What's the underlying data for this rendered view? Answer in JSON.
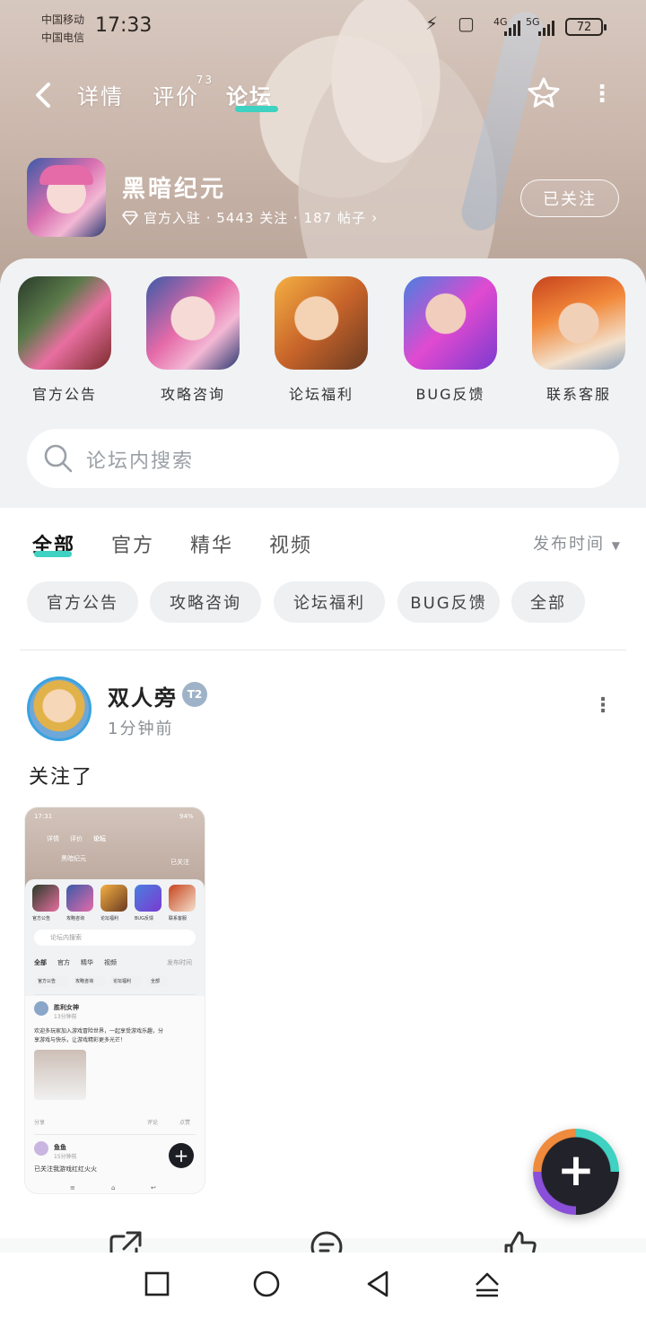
{
  "status_bar": {
    "carrier1": "中国移动",
    "carrier2": "中国电信",
    "time": "17:33",
    "net1": "4G",
    "net2": "5G",
    "battery": "72"
  },
  "nav": {
    "tabs": [
      {
        "label": "详情"
      },
      {
        "label": "评价",
        "count": "73"
      },
      {
        "label": "论坛"
      }
    ],
    "active_tab": "论坛"
  },
  "game": {
    "name": "黑暗纪元",
    "meta": "官方入驻 · 5443 关注 · 187 帖子",
    "follow_label": "已关注"
  },
  "categories": [
    {
      "label": "官方公告"
    },
    {
      "label": "攻略咨询"
    },
    {
      "label": "论坛福利"
    },
    {
      "label": "BUG反馈"
    },
    {
      "label": "联系客服"
    }
  ],
  "search": {
    "placeholder": "论坛内搜索"
  },
  "filter": {
    "tabs": [
      "全部",
      "官方",
      "精华",
      "视频"
    ],
    "sort_label": "发布时间",
    "chips": [
      "官方公告",
      "攻略咨询",
      "论坛福利",
      "BUG反馈",
      "全部"
    ]
  },
  "post": {
    "author": "双人旁",
    "level": "T2",
    "time": "1分钟前",
    "text": "关注了"
  },
  "thumb": {
    "time": "17:31",
    "battery": "94%",
    "tabs": [
      "详情",
      "评价",
      "论坛"
    ],
    "game_name": "黑暗纪元",
    "follow": "已关注",
    "cats": [
      "官方公告",
      "攻略咨询",
      "论坛福利",
      "BUG反馈",
      "联系客服"
    ],
    "search": "论坛内搜索",
    "filters": [
      "全部",
      "官方",
      "精华",
      "视频"
    ],
    "sort": "发布时间",
    "chips": [
      "官方公告",
      "攻略咨询",
      "论坛福利",
      "全部"
    ],
    "post1_author": "胜利女神",
    "post1_time": "13分钟前",
    "post1_text1": "欢迎多玩家加入游戏冒险世界，一起享受游戏乐趣，分",
    "post1_text2": "享游戏与快乐，让游戏精彩更多光芒！",
    "comment": "评论",
    "like": "点赞",
    "share": "分享",
    "post2_author": "鱼鱼",
    "post2_time": "15分钟前",
    "post2_text": "已关注我游戏红红火火"
  },
  "colors": {
    "accent": "#3fd1c1",
    "header_bg": "#ccb8ad",
    "panel_bg": "#f0f2f4"
  }
}
